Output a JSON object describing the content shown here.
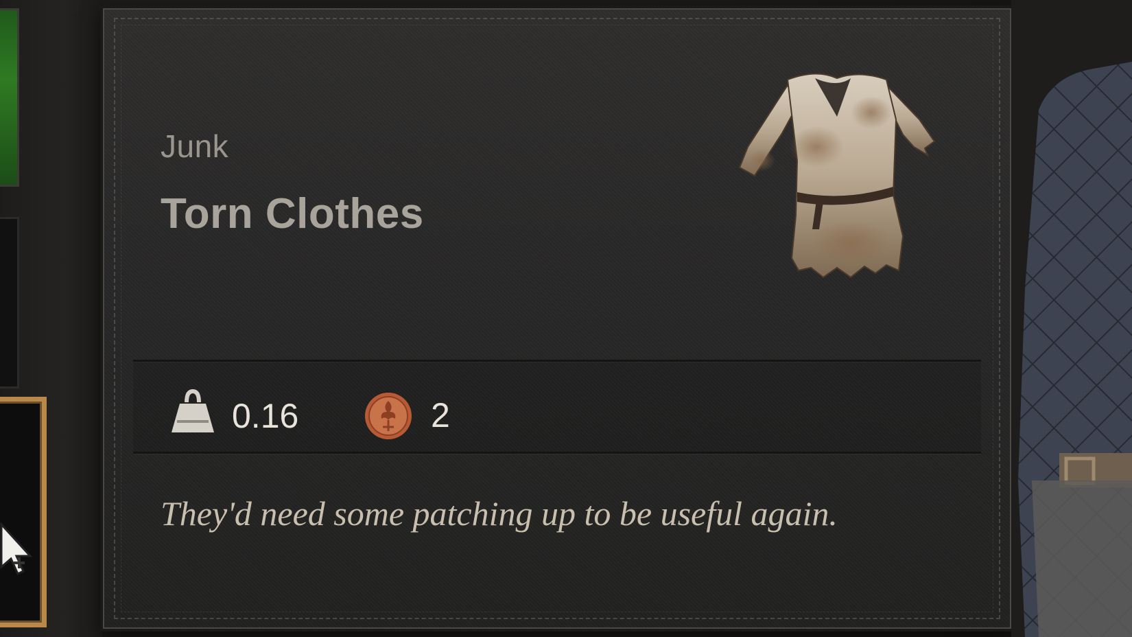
{
  "tooltip": {
    "category": "Junk",
    "item_name": "Torn Clothes",
    "weight": "0.16",
    "value": "2",
    "description": "They'd need some patching up to be useful again."
  },
  "icons": {
    "weight": "weight-icon",
    "value": "coin-icon",
    "item": "torn-clothes-icon",
    "cursor": "mouse-cursor-icon"
  },
  "colors": {
    "category_text": "#9a958d",
    "name_text": "#a8a39b",
    "stat_text": "#e8e4dc",
    "description_text": "#c9bfae",
    "coin": "#b85a35",
    "selected_slot_border": "#b8894b"
  }
}
